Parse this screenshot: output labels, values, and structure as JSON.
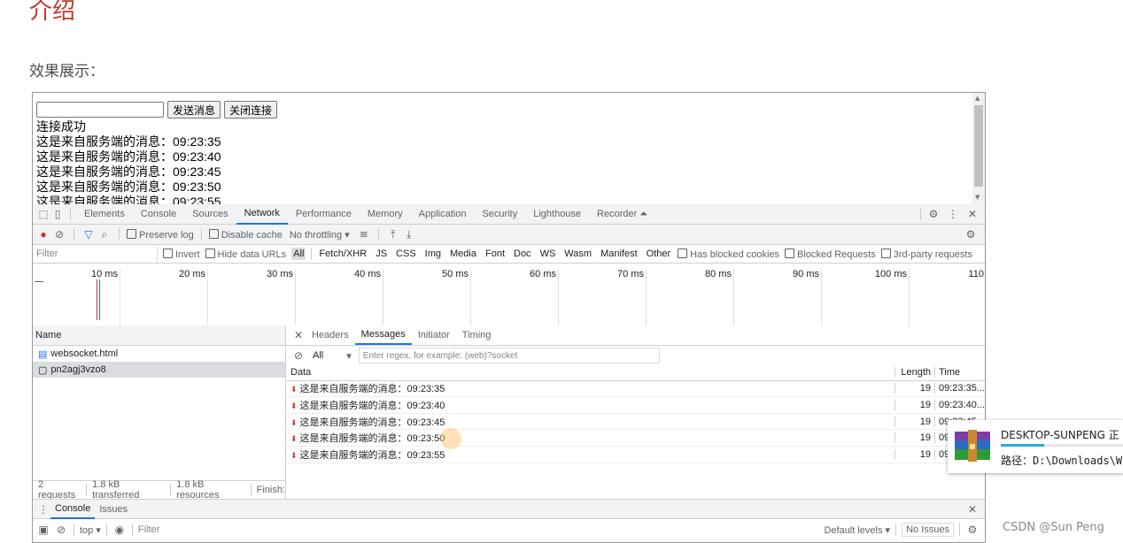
{
  "heading": "介绍",
  "subheading": "效果展示：",
  "page": {
    "send_button": "发送消息",
    "close_button": "关闭连接",
    "messages": [
      "连接成功",
      "这是来自服务端的消息：09:23:35",
      "这是来自服务端的消息：09:23:40",
      "这是来自服务端的消息：09:23:45",
      "这是来自服务端的消息：09:23:50",
      "这是来自服务端的消息：09:23:55"
    ]
  },
  "devtools": {
    "tabs": [
      "Elements",
      "Console",
      "Sources",
      "Network",
      "Performance",
      "Memory",
      "Application",
      "Security",
      "Lighthouse",
      "Recorder"
    ],
    "active_tab": "Network",
    "toolbar": {
      "preserve_log": "Preserve log",
      "disable_cache": "Disable cache",
      "throttling": "No throttling"
    },
    "filter": {
      "placeholder": "Filter",
      "invert": "Invert",
      "hide_data_urls": "Hide data URLs",
      "types": [
        "All",
        "Fetch/XHR",
        "JS",
        "CSS",
        "Img",
        "Media",
        "Font",
        "Doc",
        "WS",
        "Wasm",
        "Manifest",
        "Other"
      ],
      "has_blocked_cookies": "Has blocked cookies",
      "blocked_requests": "Blocked Requests",
      "third_party": "3rd-party requests"
    },
    "timeline_ticks": [
      "10 ms",
      "20 ms",
      "30 ms",
      "40 ms",
      "50 ms",
      "60 ms",
      "70 ms",
      "80 ms",
      "90 ms",
      "100 ms",
      "110"
    ],
    "requests": {
      "header": "Name",
      "items": [
        "websocket.html",
        "pn2agj3vzo8"
      ]
    },
    "status": [
      "2 requests",
      "1.8 kB transferred",
      "1.8 kB resources",
      "Finish:"
    ],
    "detail_tabs": [
      "Headers",
      "Messages",
      "Initiator",
      "Timing"
    ],
    "active_detail_tab": "Messages",
    "messages_filter": {
      "select": "All",
      "placeholder": "Enter regex, for example: (web)?socket"
    },
    "messages_table": {
      "headers": [
        "Data",
        "Length",
        "Time"
      ],
      "rows": [
        {
          "data": "这是来自服务端的消息：09:23:35",
          "length": "19",
          "time": "09:23:35...."
        },
        {
          "data": "这是来自服务端的消息：09:23:40",
          "length": "19",
          "time": "09:23:40...."
        },
        {
          "data": "这是来自服务端的消息：09:23:45",
          "length": "19",
          "time": "09:23:45"
        },
        {
          "data": "这是来自服务端的消息：09:23:50",
          "length": "19",
          "time": "09"
        },
        {
          "data": "这是来自服务端的消息：09:23:55",
          "length": "19",
          "time": "09"
        }
      ]
    },
    "drawer": {
      "tabs": [
        "Console",
        "Issues"
      ],
      "context": "top",
      "filter": "Filter",
      "levels": "Default levels",
      "issues": "No Issues"
    }
  },
  "toast": {
    "title": "DESKTOP-SUNPENG 正",
    "path": "路径：D:\\Downloads\\W",
    "progress": 0.35
  },
  "watermark": "CSDN @Sun  Peng"
}
